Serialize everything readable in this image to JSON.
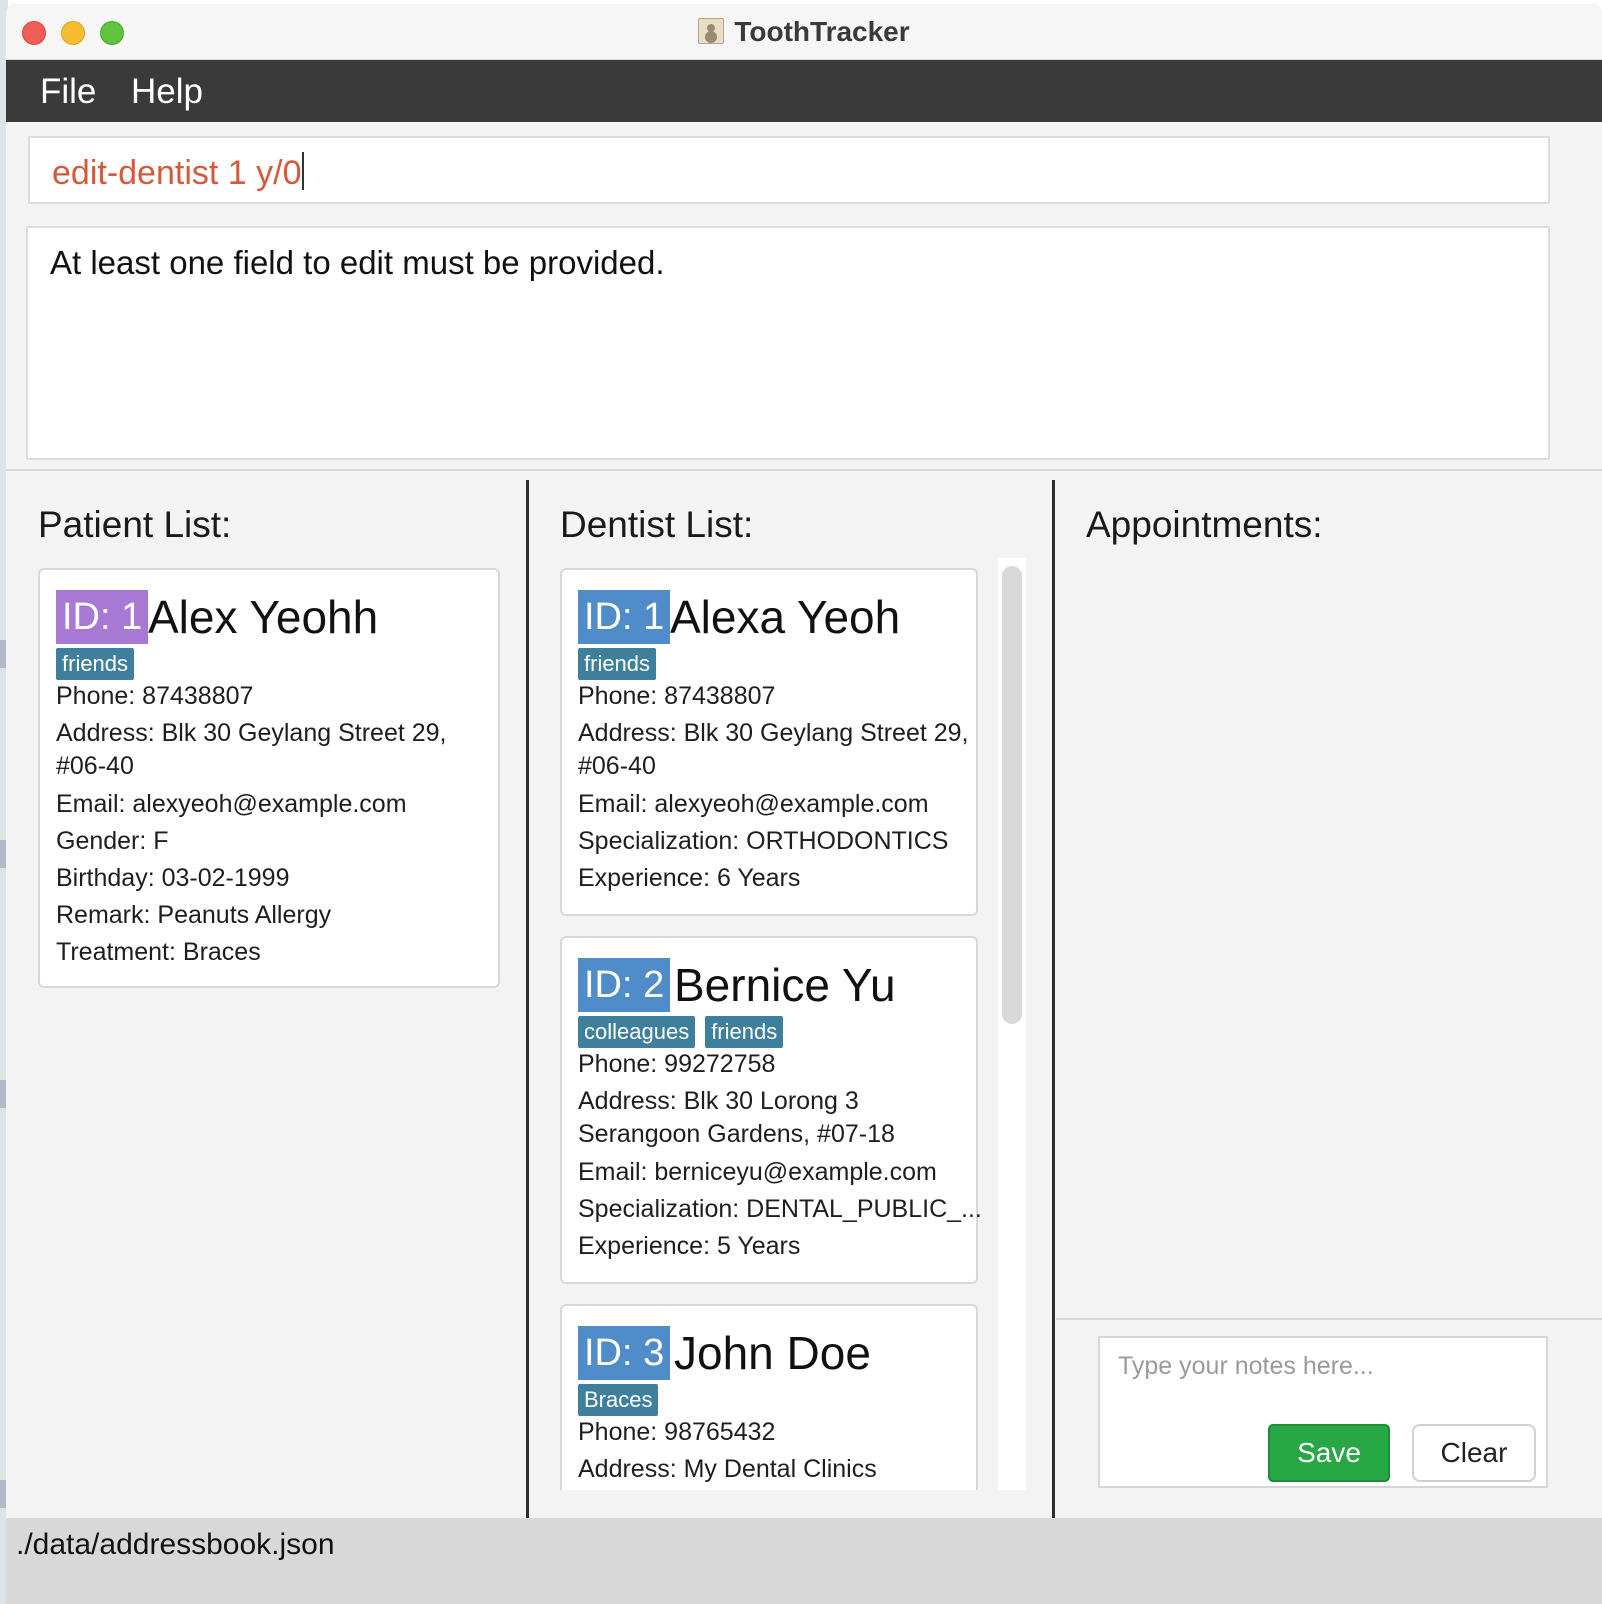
{
  "window": {
    "title": "ToothTracker"
  },
  "menu": {
    "file": "File",
    "help": "Help"
  },
  "command": {
    "text": "edit-dentist 1 y/0"
  },
  "result": {
    "text": "At least one field to edit must be provided."
  },
  "patients": {
    "title": "Patient List:",
    "items": [
      {
        "id": "ID: 1",
        "name": "Alex Yeohh",
        "tags": [
          "friends"
        ],
        "phone": "Phone: 87438807",
        "address_line1": "Address: Blk 30 Geylang Street 29,",
        "address_line2": "#06-40",
        "email": "Email: alexyeoh@example.com",
        "gender": "Gender: F",
        "birthday": "Birthday: 03-02-1999",
        "remark": "Remark: Peanuts Allergy",
        "treatment": "Treatment: Braces"
      }
    ]
  },
  "dentists": {
    "title": "Dentist List:",
    "items": [
      {
        "id": "ID: 1",
        "name": "Alexa Yeoh",
        "tags": [
          "friends"
        ],
        "phone": "Phone: 87438807",
        "address_line1": "Address: Blk 30 Geylang Street 29,",
        "address_line2": "#06-40",
        "email": "Email: alexyeoh@example.com",
        "specialization": "Specialization: ORTHODONTICS",
        "experience": "Experience: 6 Years"
      },
      {
        "id": "ID: 2",
        "name": "Bernice Yu",
        "tags": [
          "colleagues",
          "friends"
        ],
        "phone": "Phone: 99272758",
        "address_line1": "Address: Blk 30 Lorong 3",
        "address_line2": "Serangoon Gardens, #07-18",
        "email": "Email: berniceyu@example.com",
        "specialization": "Specialization: DENTAL_PUBLIC_...",
        "experience": "Experience: 5 Years"
      },
      {
        "id": "ID: 3",
        "name": "John Doe",
        "tags": [
          "Braces"
        ],
        "phone": "Phone: 98765432",
        "address_line1": "Address: My Dental Clinics"
      }
    ]
  },
  "appointments": {
    "title": "Appointments:",
    "notes_placeholder": "Type your notes here...",
    "save_label": "Save",
    "clear_label": "Clear"
  },
  "status": {
    "path": "./data/addressbook.json"
  },
  "colors": {
    "patient_id_badge": "#a879d4",
    "dentist_id_badge": "#4f8cc9",
    "tag": "#3f7f9e",
    "command_text": "#d45a3a",
    "save_button": "#28a745",
    "menubar": "#3a3a3a"
  }
}
